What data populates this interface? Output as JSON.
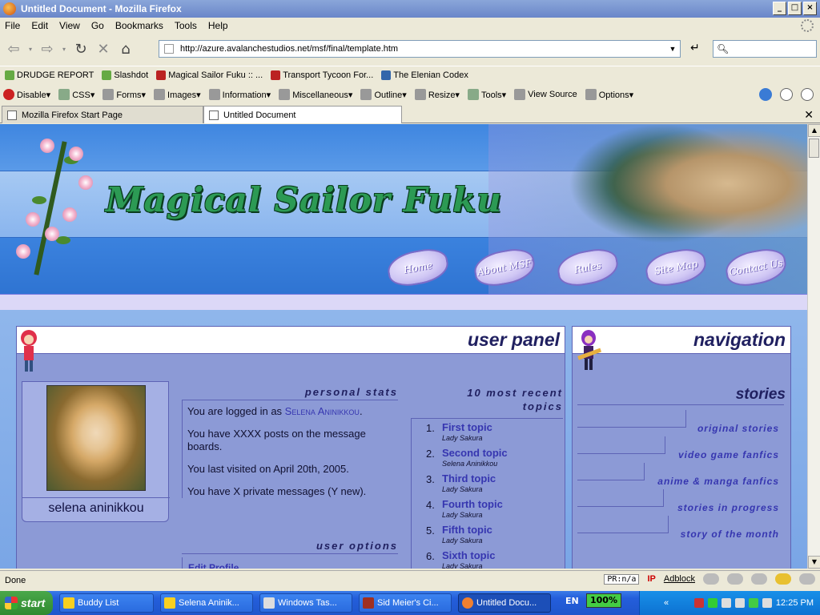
{
  "window": {
    "title": "Untitled Document - Mozilla Firefox"
  },
  "menu": [
    "File",
    "Edit",
    "View",
    "Go",
    "Bookmarks",
    "Tools",
    "Help"
  ],
  "address": {
    "url": "http://azure.avalanchestudios.net/msf/final/template.htm"
  },
  "bookmarks": [
    "DRUDGE REPORT",
    "Slashdot",
    "Magical Sailor Fuku :: ...",
    "Transport Tycoon For...",
    "The Elenian Codex"
  ],
  "devtools": [
    "Disable▾",
    "CSS▾",
    "Forms▾",
    "Images▾",
    "Information▾",
    "Miscellaneous▾",
    "Outline▾",
    "Resize▾",
    "Tools▾",
    "View Source",
    "Options▾"
  ],
  "tabs": [
    "Mozilla Firefox Start Page",
    "Untitled Document"
  ],
  "site": {
    "logo": "Magical Sailor Fuku",
    "nav_buttons": [
      "Home",
      "About MSF",
      "Rules",
      "Site Map",
      "Contact Us"
    ]
  },
  "user_panel": {
    "title": "user panel",
    "avatar_name": "selena aninikkou",
    "stats_heading": "personal stats",
    "logged_in_prefix": "You are logged in as ",
    "logged_in_user": "Selena Aninikkou",
    "logged_in_suffix": ".",
    "posts_text": "You have XXXX posts on the message boards.",
    "visited_text": "You last visited on April 20th, 2005.",
    "pm_text": "You have X private messages (Y new).",
    "options_heading": "user options",
    "options_first": "Edit Profile",
    "topics_heading_1": "10 most recent",
    "topics_heading_2": "topics",
    "topics": [
      {
        "num": "1.",
        "name": "First topic",
        "author": "Lady Sakura"
      },
      {
        "num": "2.",
        "name": "Second topic",
        "author": "Selena Aninikkou"
      },
      {
        "num": "3.",
        "name": "Third topic",
        "author": "Lady Sakura"
      },
      {
        "num": "4.",
        "name": "Fourth topic",
        "author": "Lady Sakura"
      },
      {
        "num": "5.",
        "name": "Fifth topic",
        "author": "Lady Sakura"
      },
      {
        "num": "6.",
        "name": "Sixth topic",
        "author": "Lady Sakura"
      }
    ]
  },
  "navigation": {
    "title": "navigation",
    "stories_heading": "stories",
    "links": [
      "original stories",
      "video game fanfics",
      "anime & manga fanfics",
      "stories in progress",
      "story of the month"
    ]
  },
  "status": {
    "text": "Done",
    "pr": "PR:n/a",
    "ip": "IP",
    "adblock": "Adblock"
  },
  "taskbar": {
    "start": "start",
    "tasks": [
      "Buddy List",
      "Selena Aninik...",
      "Windows Tas...",
      "Sid Meier's Ci...",
      "Untitled Docu..."
    ],
    "lang": "EN",
    "battery": "100%",
    "clock": "12:25 PM"
  }
}
